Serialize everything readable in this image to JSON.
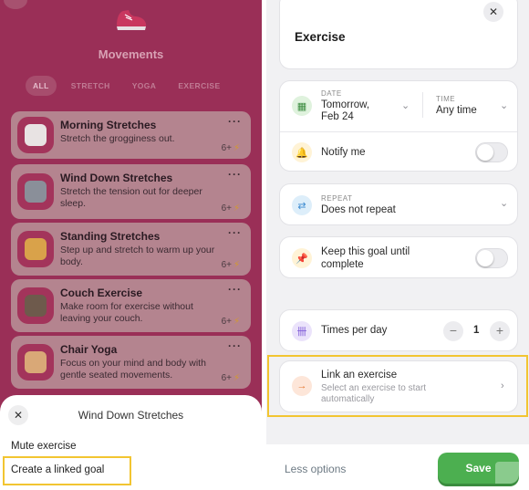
{
  "left": {
    "title": "Movements",
    "filters": [
      "ALL",
      "STRETCH",
      "YOGA",
      "EXERCISE"
    ],
    "cards": [
      {
        "title": "Morning Stretches",
        "desc": "Stretch the grogginess out.",
        "points": "6+",
        "thumb_color": "#e8e3e3"
      },
      {
        "title": "Wind Down Stretches",
        "desc": "Stretch the tension out for deeper sleep.",
        "points": "6+",
        "thumb_color": "#8a8f99"
      },
      {
        "title": "Standing Stretches",
        "desc": "Step up and stretch to warm up your body.",
        "points": "6+",
        "thumb_color": "#d9a24a"
      },
      {
        "title": "Couch Exercise",
        "desc": "Make room for exercise without leaving your couch.",
        "points": "6+",
        "thumb_color": "#6e5a4c"
      },
      {
        "title": "Chair Yoga",
        "desc": "Focus on your mind and body with gentle seated movements.",
        "points": "6+",
        "thumb_color": "#d9a877"
      }
    ],
    "sheet": {
      "title": "Wind Down Stretches",
      "options": [
        "Mute exercise",
        "Create a linked goal"
      ]
    }
  },
  "right": {
    "title": "Exercise",
    "date": {
      "label": "DATE",
      "value": "Tomorrow, Feb 24"
    },
    "time": {
      "label": "TIME",
      "value": "Any time"
    },
    "notify": "Notify me",
    "repeat": {
      "label": "REPEAT",
      "value": "Does not repeat"
    },
    "keep_goal": "Keep this goal until complete",
    "times_per_day": {
      "label": "Times per day",
      "value": "1",
      "minus": "−",
      "plus": "+"
    },
    "link": {
      "title": "Link an exercise",
      "subtitle": "Select an exercise to start automatically"
    },
    "less_options": "Less options",
    "save": "Save"
  },
  "colors": {
    "accent_highlight": "#f2c531",
    "save_green": "#4caf50",
    "left_bg": "#9a2f57"
  }
}
